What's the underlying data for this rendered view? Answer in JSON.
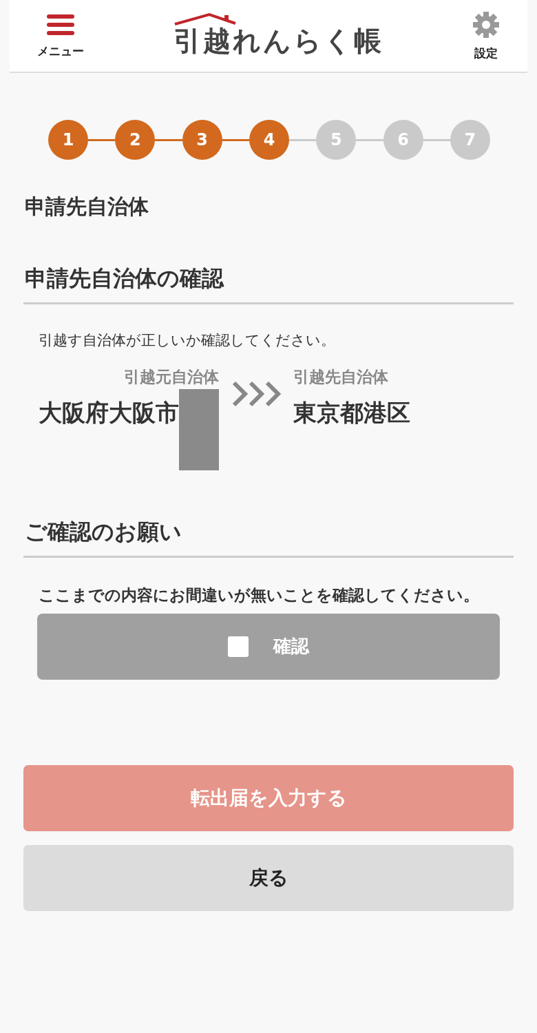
{
  "header": {
    "menu_label": "メニュー",
    "logo": "引越れんらく帳",
    "settings_label": "設定"
  },
  "steps": [
    {
      "label": "1",
      "done": true
    },
    {
      "label": "2",
      "done": true
    },
    {
      "label": "3",
      "done": true
    },
    {
      "label": "4",
      "done": true
    },
    {
      "label": "5",
      "done": false
    },
    {
      "label": "6",
      "done": false
    },
    {
      "label": "7",
      "done": false
    }
  ],
  "page_title": "申請先自治体",
  "section_1": {
    "heading": "申請先自治体の確認",
    "instruction": "引越す自治体が正しいか確認してください。",
    "from": {
      "caption": "引越元自治体",
      "name": "大阪府大阪市",
      "redacted": true
    },
    "to": {
      "caption": "引越先自治体",
      "name": "東京都港区"
    }
  },
  "section_2": {
    "heading": "ご確認のお願い",
    "instruction": "ここまでの内容にお間違いが無いことを確認してください。",
    "confirm": {
      "label": "確認",
      "checked": false
    }
  },
  "buttons": [
    {
      "label": "転出届を入力する",
      "kind": "primary",
      "disabled": true
    },
    {
      "label": "戻る",
      "kind": "secondary",
      "disabled": false
    }
  ]
}
